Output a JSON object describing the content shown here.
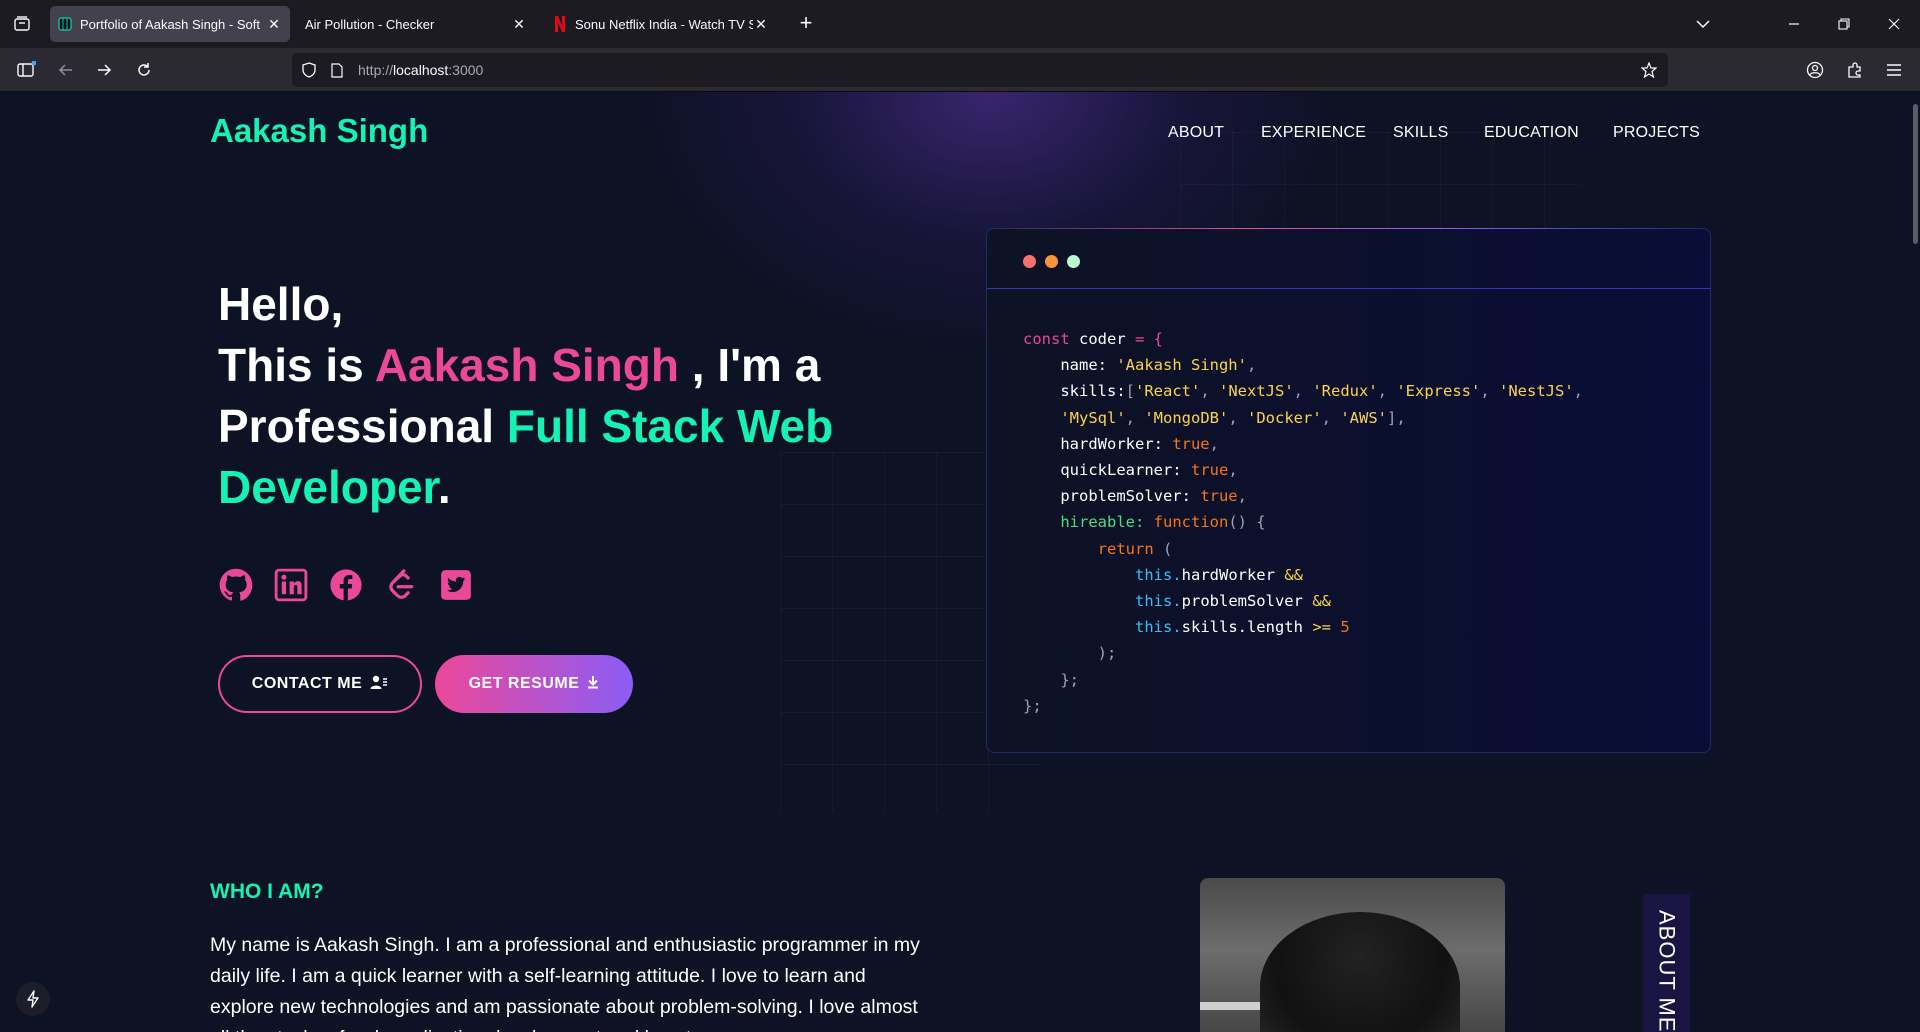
{
  "browser": {
    "tabs": [
      {
        "title": "Portfolio of Aakash Singh - Soft",
        "favicon": "grid-favicon",
        "active": true
      },
      {
        "title": "Air Pollution - Checker",
        "favicon": "none",
        "active": false
      },
      {
        "title": "Sonu Netflix India - Watch TV Sh",
        "favicon": "netflix-favicon",
        "active": false
      }
    ],
    "url_scheme": "http://",
    "url_host": "localhost",
    "url_port": ":3000"
  },
  "site": {
    "brand": "Aakash Singh",
    "menu": [
      "ABOUT",
      "EXPERIENCE",
      "SKILLS",
      "EDUCATION",
      "PROJECTS"
    ]
  },
  "hero": {
    "line1": "Hello,",
    "this_is": "This is ",
    "name": "Aakash Singh",
    "im_a": " , I'm a",
    "professional": "Professional ",
    "role1": "Full Stack Web",
    "role2": "Developer",
    "period": ".",
    "socials": [
      "github-icon",
      "linkedin-icon",
      "facebook-icon",
      "leetcode-icon",
      "twitter-icon"
    ],
    "contact_label": "CONTACT ME",
    "resume_label": "GET RESUME"
  },
  "code": {
    "l1_kw": "const",
    "l1_var": " coder ",
    "l1_eq": "= {",
    "name_key": "name: ",
    "name_val": "'Aakash Singh'",
    "skills_key": "skills:",
    "skills_open": "[",
    "skills_row1": [
      "'React'",
      "'NextJS'",
      "'Redux'",
      "'Express'",
      "'NestJS'"
    ],
    "skills_row2": [
      "'MySql'",
      "'MongoDB'",
      "'Docker'",
      "'AWS'"
    ],
    "skills_close": "],",
    "hardWorker_key": "hardWorker: ",
    "quickLearner_key": "quickLearner: ",
    "problemSolver_key": "problemSolver: ",
    "true_val": "true",
    "hireable_key": "hireable: ",
    "function_kw": "function",
    "function_rest": "() {",
    "return_kw": "return",
    "return_paren": " (",
    "this_kw": "this.",
    "hw_prop": "hardWorker ",
    "ps_prop": "problemSolver ",
    "sl_prop": "skills.length ",
    "and_op": "&&",
    "gte_op": ">=",
    "five": " 5",
    "close_paren": ");",
    "close_fn": "};",
    "close_obj": "};"
  },
  "about": {
    "title": "WHO I AM?",
    "text": "My name is Aakash Singh. I am a professional and enthusiastic programmer in my daily life. I am a quick learner with a self-learning attitude. I love to learn and explore new technologies and am passionate about problem-solving. I love almost all the stacks of web application development and love to",
    "side_label": "ABOUT ME"
  },
  "colors": {
    "accent_green": "#16f2b3",
    "accent_pink": "#ec4899",
    "accent_purple": "#8b5cf6",
    "background": "#0d1224"
  }
}
